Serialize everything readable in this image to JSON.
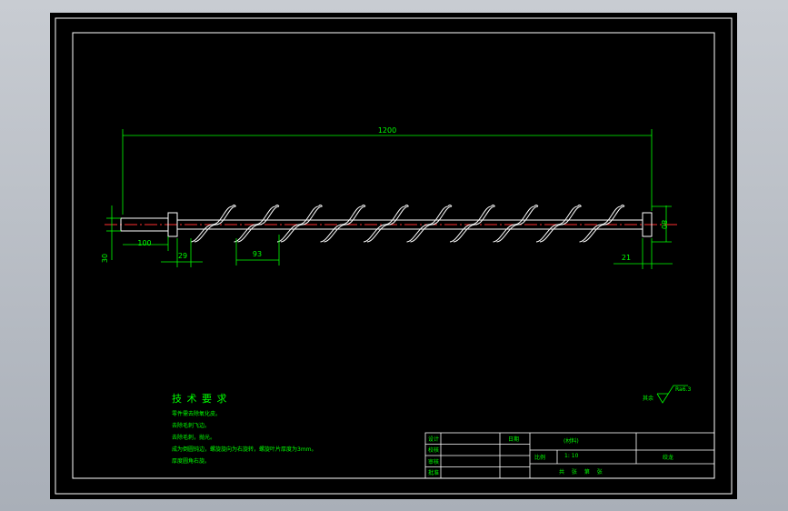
{
  "drawing": {
    "dimensions": {
      "overall_length": "1200",
      "shaft_end_length": "100",
      "shaft_diameter": "30",
      "flight_width": "29",
      "pitch": "93",
      "end_length": "21",
      "flight_diameter": "80"
    },
    "tech_req": {
      "title": "技 术 要 求",
      "lines": [
        "零件需去除氧化皮。",
        "去除毛刺飞边。",
        "去除毛刺，抛光。",
        "成为倒圆钝边，螺旋旋向为右旋转，螺旋叶片厚度为3mm。",
        "厚度圆角右旋。"
      ]
    },
    "roughness": {
      "label": "其余",
      "value": "Ra6.3"
    },
    "title_block": {
      "design": "设计",
      "check": "校核",
      "review": "审核",
      "approve": "批准",
      "date": "日期",
      "material": "(材料)",
      "scale_label": "比例",
      "scale_value": "1: 10",
      "part_name": "绞龙",
      "sheet_info": "共  张  第  张"
    }
  }
}
